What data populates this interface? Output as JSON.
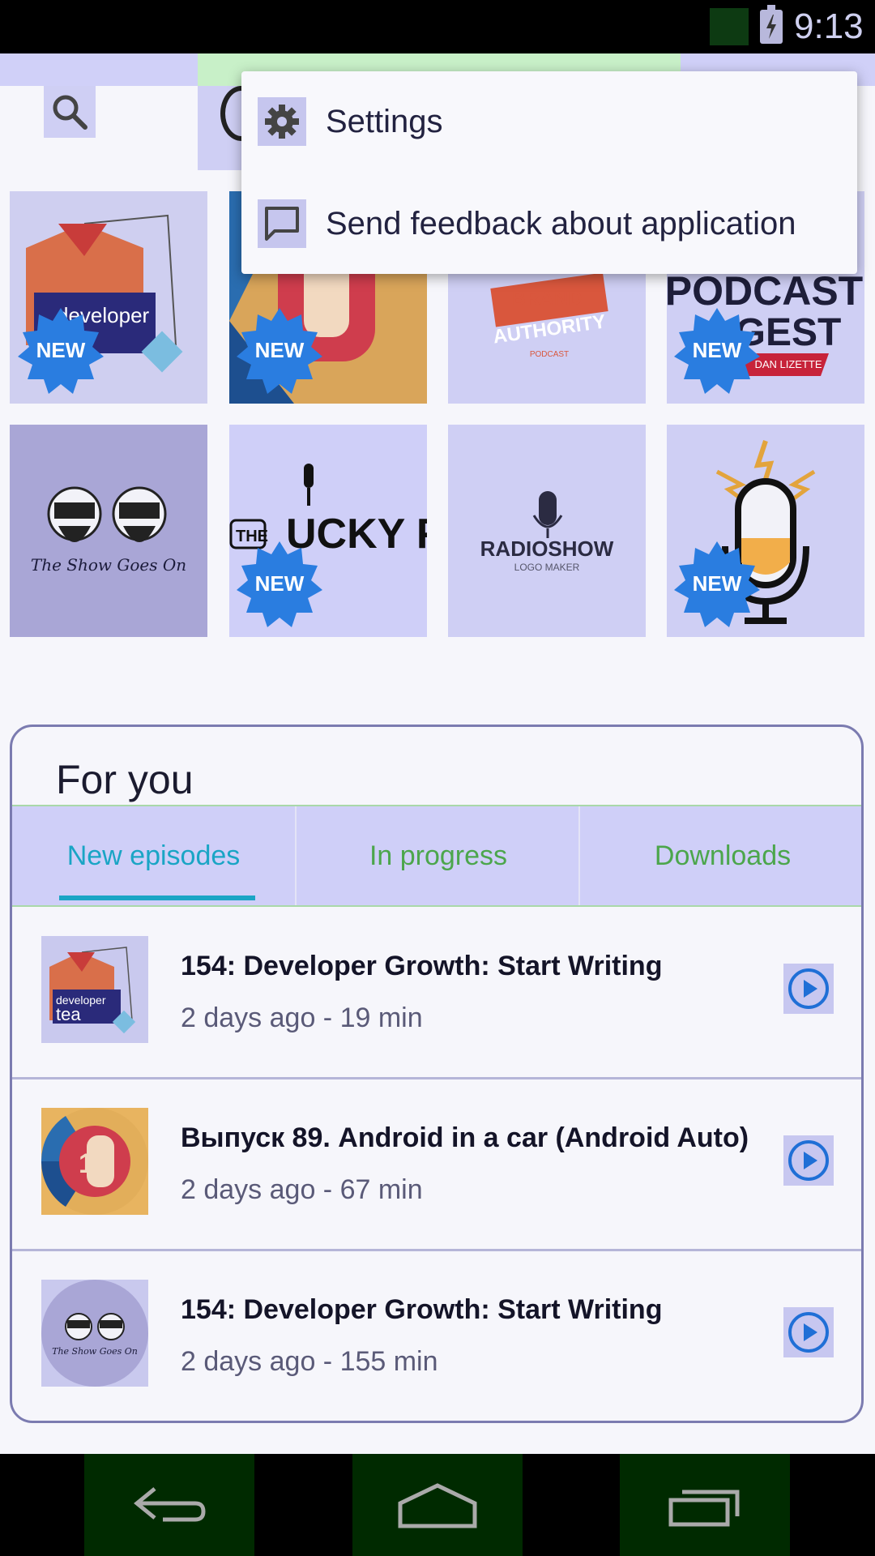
{
  "status_bar": {
    "time": "9:13"
  },
  "menu": {
    "items": [
      {
        "label": "Settings",
        "icon": "gear-icon"
      },
      {
        "label": "Send feedback about application",
        "icon": "feedback-icon"
      }
    ]
  },
  "grid": {
    "new_badge": "NEW",
    "tiles": [
      {
        "name": "developer tea",
        "text": "developer",
        "is_new": true
      },
      {
        "name": "1D",
        "text": "",
        "is_new": true
      },
      {
        "name": "brand authority",
        "text": "BRAND AUTHORITY",
        "sub": "PODCAST",
        "is_new": false
      },
      {
        "name": "podcast digest",
        "text": "PODCAST",
        "text2": "GEST",
        "sub": "DAN LIZETTE",
        "is_new": true
      },
      {
        "name": "the show goes on",
        "text": "The Show Goes On",
        "is_new": false
      },
      {
        "name": "the lucky few",
        "text": "THE",
        "text2": "UCKY FEW",
        "is_new": true
      },
      {
        "name": "radioshow",
        "text": "RADIOSHOW",
        "sub": "LOGO MAKER",
        "is_new": false
      },
      {
        "name": "microphone",
        "text": "",
        "is_new": true
      }
    ]
  },
  "for_you": {
    "title": "For you",
    "tabs": [
      "New episodes",
      "In progress",
      "Downloads"
    ],
    "active_tab": 0,
    "episodes": [
      {
        "title": "154: Developer Growth: Start Writing",
        "meta": "2 days ago - 19 min",
        "thumb_text": "developer",
        "thumb_text2": "tea"
      },
      {
        "title": "Выпуск 89. Android in a car (Android Auto)",
        "meta": "2 days ago - 67 min"
      },
      {
        "title": "154: Developer Growth: Start Writing",
        "meta": "2 days ago - 155 min",
        "thumb_text": "The Show Goes On"
      }
    ]
  },
  "colors": {
    "accent_tab": "#1aa5c5",
    "inactive_tab": "#4ca64c",
    "new_badge": "#2a7de0",
    "play": "#1f6fd6"
  }
}
